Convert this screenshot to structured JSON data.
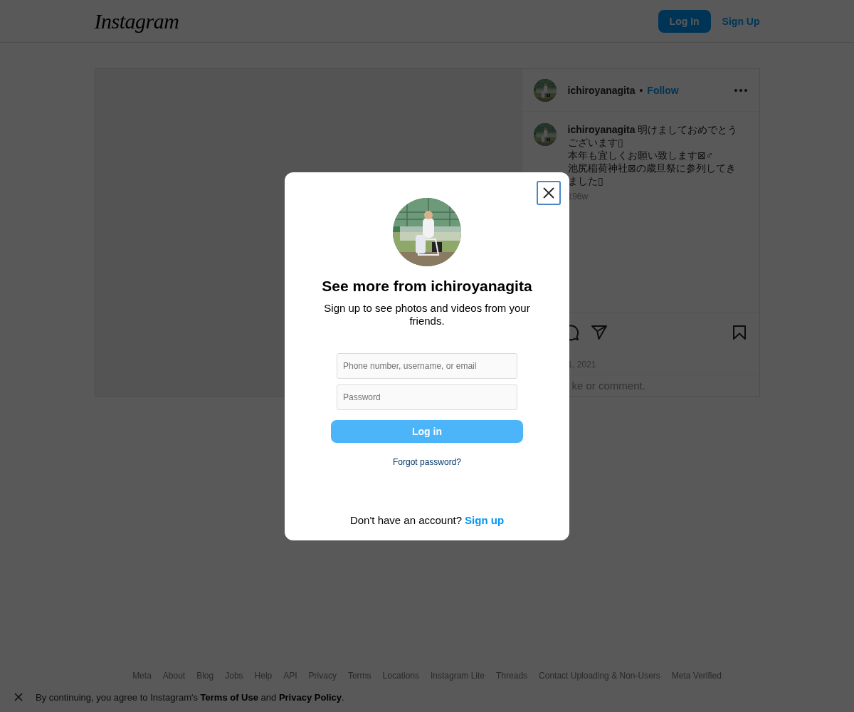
{
  "header": {
    "logo": "Instagram",
    "buttons": [
      {
        "label": "Log In",
        "kind": "primary"
      },
      {
        "label": "Sign Up",
        "kind": "link"
      }
    ]
  },
  "post": {
    "author": "ichiroyanagita",
    "separator": "•",
    "follow": "Follow",
    "caption": "**ichiroyanagita** 明けましておめでとうございます▯\n本年も宜しくお願い致します⊠♂\n池尻稲荷神社⊠の歳旦祭に参列してきました▯",
    "age": "196w",
    "date": "1, 2021",
    "comment_hint": "ke or comment."
  },
  "modal": {
    "title": "See more from ichiroyanagita",
    "subtitle": "Sign up to see photos and videos from your friends.",
    "fields": [
      {
        "placeholder": "Phone number, username, or email"
      },
      {
        "placeholder": "Password"
      }
    ],
    "login_button": "Log in",
    "forgot": "Forgot password?",
    "signup_prompt": "Don't have an account?",
    "signup_link": "Sign up"
  },
  "footer": {
    "links": [
      "Meta",
      "About",
      "Blog",
      "Jobs",
      "Help",
      "API",
      "Privacy",
      "Terms",
      "Locations",
      "Instagram Lite",
      "Threads",
      "Contact Uploading & Non-Users",
      "Meta Verified"
    ]
  },
  "cookie_bar": {
    "text": "By continuing, you agree to Instagram's **Terms of Use** and **Privacy Policy**."
  }
}
